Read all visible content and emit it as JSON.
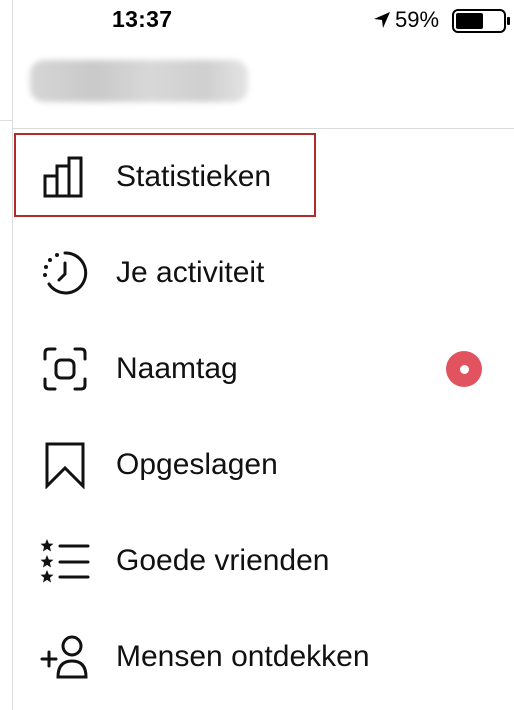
{
  "status_bar": {
    "time": "13:37",
    "battery_percent": "59%",
    "battery_level": 0.59
  },
  "menu": {
    "items": [
      {
        "label": "Statistieken",
        "icon": "bar-chart-icon",
        "highlighted": true
      },
      {
        "label": "Je activiteit",
        "icon": "activity-clock-icon"
      },
      {
        "label": "Naamtag",
        "icon": "nametag-scan-icon",
        "has_notification": true
      },
      {
        "label": "Opgeslagen",
        "icon": "bookmark-icon"
      },
      {
        "label": "Goede vrienden",
        "icon": "close-friends-list-icon"
      },
      {
        "label": "Mensen ontdekken",
        "icon": "add-person-icon"
      }
    ]
  },
  "colors": {
    "highlight_border": "#b22a2a",
    "notification_dot": "#e0535f"
  }
}
